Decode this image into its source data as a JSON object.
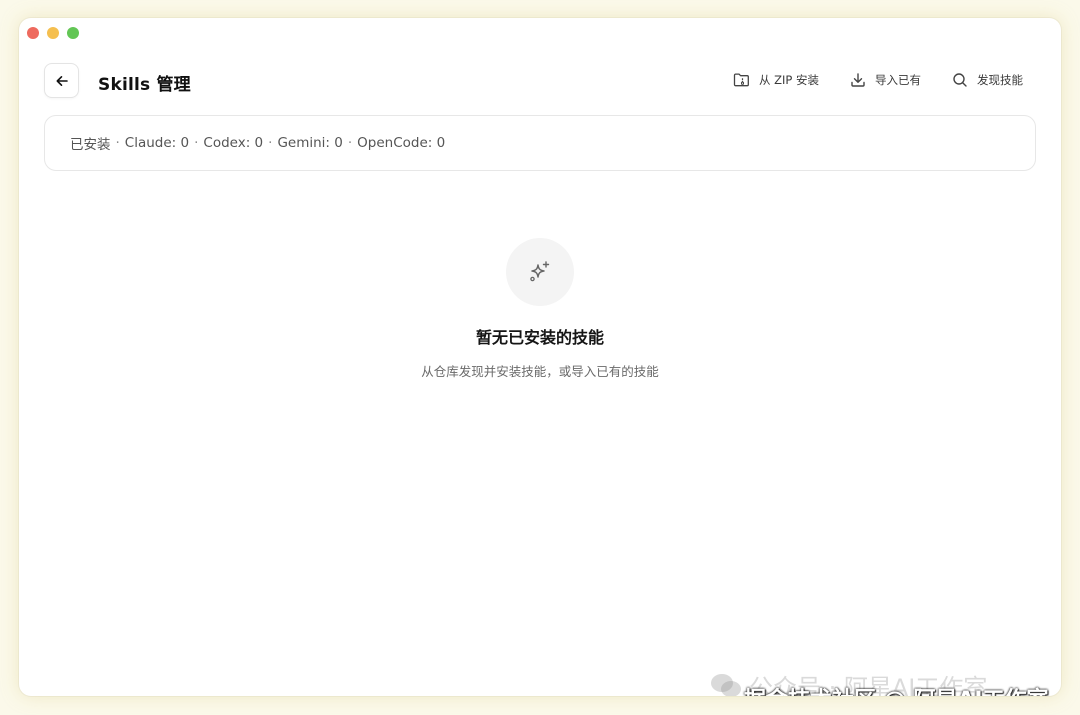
{
  "window": {
    "traffic_lights": {
      "close_color": "#ee6a5e",
      "minimize_color": "#f5bf4f",
      "maximize_color": "#62c655"
    }
  },
  "header": {
    "back_icon": "arrow-left-icon",
    "title": "Skills 管理",
    "actions": [
      {
        "label": "从 ZIP 安装",
        "icon": "folder-zip-icon"
      },
      {
        "label": "导入已有",
        "icon": "download-icon"
      },
      {
        "label": "发现技能",
        "icon": "search-icon"
      }
    ]
  },
  "summary": {
    "installed_label": "已安装",
    "separator": "·",
    "items": [
      {
        "label": "Claude: 0"
      },
      {
        "label": "Codex: 0"
      },
      {
        "label": "Gemini: 0"
      },
      {
        "label": "OpenCode: 0"
      }
    ]
  },
  "empty_state": {
    "icon": "sparkles-icon",
    "title": "暂无已安装的技能",
    "description": "从仓库发现并安装技能，或导入已有的技能"
  },
  "watermark": {
    "faint_text": "公众号 · 阿星AI工作室",
    "main_text": "掘金技术社区 @ 阿星AI工作室"
  }
}
